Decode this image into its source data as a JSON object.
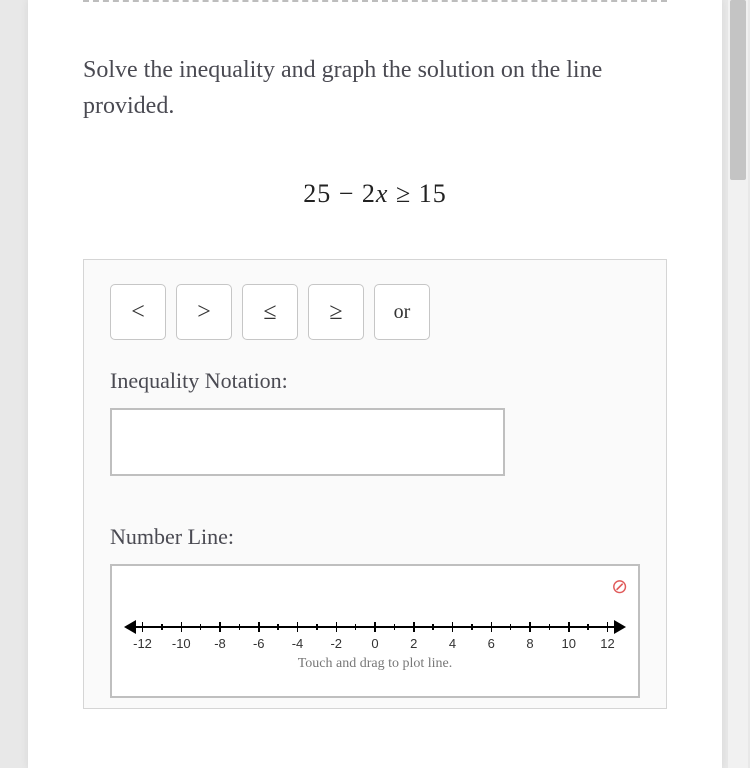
{
  "prompt": "Solve the inequality and graph the solution on the line provided.",
  "equation": {
    "part1": "25 − 2",
    "var": "x",
    "part2": " ≥ 15"
  },
  "symbols": {
    "lt": "<",
    "gt": ">",
    "le": "≤",
    "ge": "≥",
    "or": "or"
  },
  "labels": {
    "inequality": "Inequality Notation:",
    "numberline": "Number Line:",
    "hint": "Touch and drag to plot line."
  },
  "answer_value": "",
  "ticks": [
    {
      "label": "-12",
      "major": true
    },
    {
      "label": "",
      "major": false
    },
    {
      "label": "-10",
      "major": true
    },
    {
      "label": "",
      "major": false
    },
    {
      "label": "-8",
      "major": true
    },
    {
      "label": "",
      "major": false
    },
    {
      "label": "-6",
      "major": true
    },
    {
      "label": "",
      "major": false
    },
    {
      "label": "-4",
      "major": true
    },
    {
      "label": "",
      "major": false
    },
    {
      "label": "-2",
      "major": true
    },
    {
      "label": "",
      "major": false
    },
    {
      "label": "0",
      "major": true
    },
    {
      "label": "",
      "major": false
    },
    {
      "label": "2",
      "major": true
    },
    {
      "label": "",
      "major": false
    },
    {
      "label": "4",
      "major": true
    },
    {
      "label": "",
      "major": false
    },
    {
      "label": "6",
      "major": true
    },
    {
      "label": "",
      "major": false
    },
    {
      "label": "8",
      "major": true
    },
    {
      "label": "",
      "major": false
    },
    {
      "label": "10",
      "major": true
    },
    {
      "label": "",
      "major": false
    },
    {
      "label": "12",
      "major": true
    }
  ]
}
